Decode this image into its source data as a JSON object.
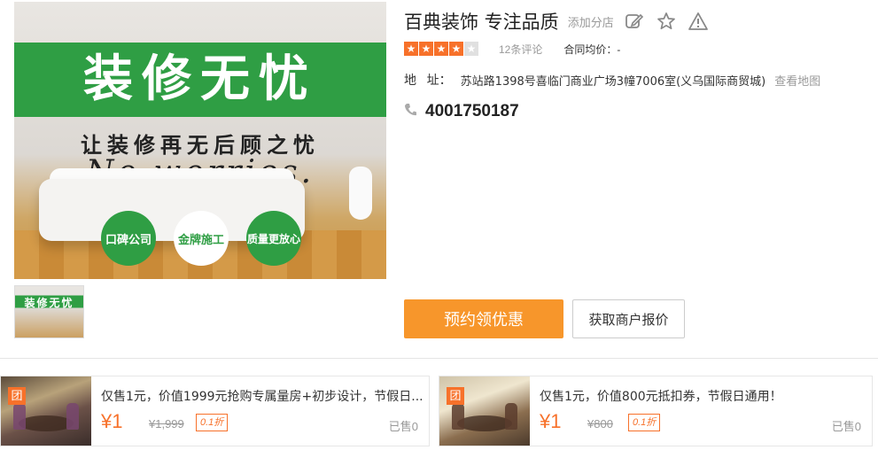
{
  "hero": {
    "headline": "装修无忧",
    "subline": "让装修再无后顾之忧",
    "english": "No worries.",
    "badges": [
      "口碑公司",
      "金牌施工",
      "质量更放心"
    ]
  },
  "thumb": {
    "label": "装修无忧"
  },
  "shop": {
    "name": "百典装饰 专注品质",
    "add_branch": "添加分店",
    "rating_stars": 4,
    "rating_max": 5,
    "review_count": "12条评论",
    "contract_price": "合同均价：-",
    "address_label": "地   址：",
    "address": "苏站路1398号喜临门商业广场3幢7006室(义乌国际商贸城)",
    "map_link": "查看地图",
    "phone": "4001750187"
  },
  "buttons": {
    "primary": "预约领优惠",
    "secondary": "获取商户报价"
  },
  "deals": [
    {
      "badge": "团",
      "title": "仅售1元，价值1999元抢购专属量房+初步设计，节假日...",
      "price": "¥1",
      "original": "¥1,999",
      "discount": "0.1折",
      "sold": "已售0"
    },
    {
      "badge": "团",
      "title": "仅售1元，价值800元抵扣券，节假日通用！",
      "price": "¥1",
      "original": "¥800",
      "discount": "0.1折",
      "sold": "已售0"
    }
  ],
  "colors": {
    "brand_orange": "#f7712a",
    "button_orange": "#f7962b",
    "hero_green": "#2f9e44"
  }
}
